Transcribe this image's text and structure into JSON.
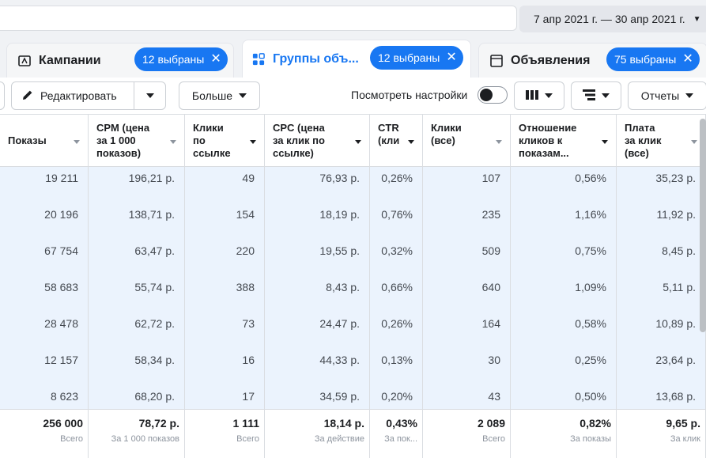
{
  "header": {
    "date_range": "7 апр 2021 г. — 30 апр 2021 г."
  },
  "tabs": [
    {
      "label": "Кампании",
      "selected": "12 выбраны"
    },
    {
      "label": "Группы объ...",
      "selected": "12 выбраны"
    },
    {
      "label": "Объявления",
      "selected": "75 выбраны"
    }
  ],
  "toolbar": {
    "edit_label": "Редактировать",
    "more_label": "Больше",
    "view_settings_label": "Посмотреть настройки",
    "reports_label": "Отчеты"
  },
  "table": {
    "columns": [
      {
        "header": [
          "Показы"
        ],
        "footer_value": "256 000",
        "footer_label": "Всего",
        "cells": [
          "19 211",
          "20 196",
          "67 754",
          "58 683",
          "28 478",
          "12 157",
          "8 623"
        ]
      },
      {
        "header": [
          "CPM (цена",
          "за 1 000",
          "показов)"
        ],
        "footer_value": "78,72 р.",
        "footer_label": "За 1 000 показов",
        "cells": [
          "196,21 р.",
          "138,71 р.",
          "63,47 р.",
          "55,74 р.",
          "62,72 р.",
          "58,34 р.",
          "68,20 р."
        ]
      },
      {
        "header": [
          "Клики",
          "по",
          "ссылке"
        ],
        "footer_value": "1 111",
        "footer_label": "Всего",
        "cells": [
          "49",
          "154",
          "220",
          "388",
          "73",
          "16",
          "17"
        ]
      },
      {
        "header": [
          "CPC (цена",
          "за клик по",
          "ссылке)"
        ],
        "footer_value": "18,14 р.",
        "footer_label": "За действие",
        "cells": [
          "76,93 р.",
          "18,19 р.",
          "19,55 р.",
          "8,43 р.",
          "24,47 р.",
          "44,33 р.",
          "34,59 р."
        ]
      },
      {
        "header": [
          "CTR",
          "(кли"
        ],
        "footer_value": "0,43%",
        "footer_label": "За пок...",
        "cells": [
          "0,26%",
          "0,76%",
          "0,32%",
          "0,66%",
          "0,26%",
          "0,13%",
          "0,20%"
        ]
      },
      {
        "header": [
          "Клики",
          "(все)"
        ],
        "footer_value": "2 089",
        "footer_label": "Всего",
        "cells": [
          "107",
          "235",
          "509",
          "640",
          "164",
          "30",
          "43"
        ]
      },
      {
        "header": [
          "Отношение",
          "кликов к",
          "показам..."
        ],
        "footer_value": "0,82%",
        "footer_label": "За показы",
        "cells": [
          "0,56%",
          "1,16%",
          "0,75%",
          "1,09%",
          "0,58%",
          "0,25%",
          "0,50%"
        ]
      },
      {
        "header": [
          "Плата",
          "за клик",
          "(все)"
        ],
        "footer_value": "9,65 р.",
        "footer_label": "За клик",
        "cells": [
          "35,23 р.",
          "11,92 р.",
          "8,45 р.",
          "5,11 р.",
          "10,89 р.",
          "23,64 р.",
          "13,68 р."
        ]
      }
    ]
  }
}
